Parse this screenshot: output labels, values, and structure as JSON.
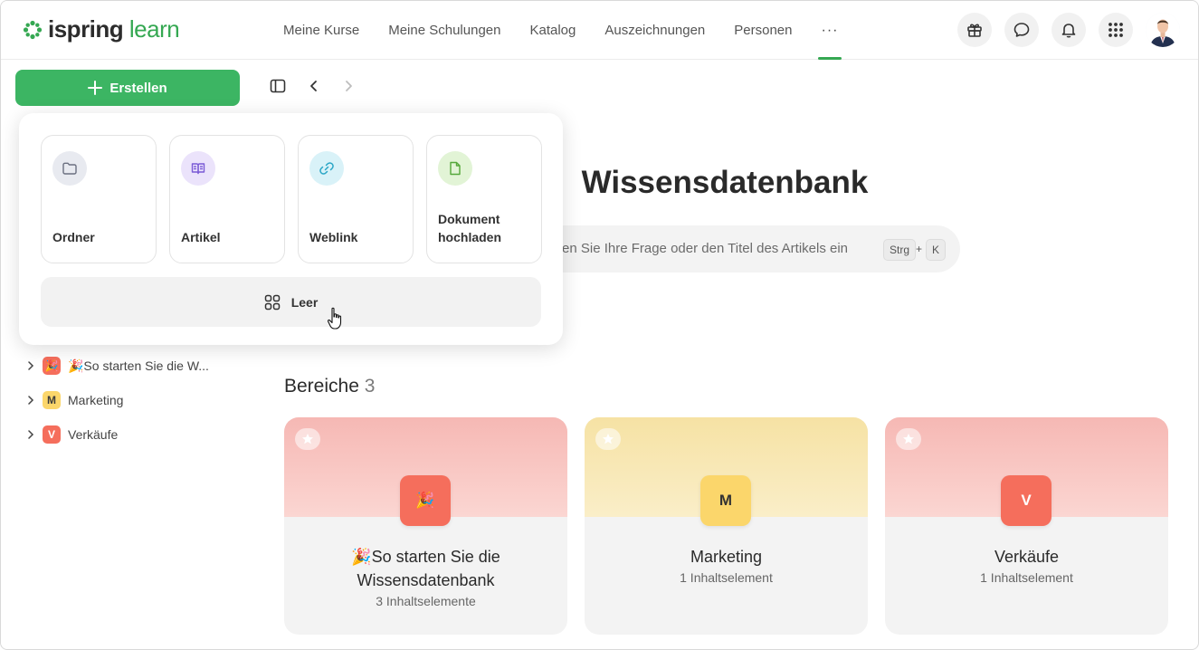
{
  "header": {
    "logo": {
      "brand": "ispring",
      "product": "learn"
    },
    "nav": [
      {
        "label": "Meine Kurse"
      },
      {
        "label": "Meine Schulungen"
      },
      {
        "label": "Katalog"
      },
      {
        "label": "Auszeichnungen"
      },
      {
        "label": "Personen"
      },
      {
        "label": "···"
      }
    ],
    "icons": [
      "gift-icon",
      "chat-icon",
      "bell-icon",
      "apps-grid-icon"
    ]
  },
  "sidebar": {
    "create_label": "Erstellen",
    "tree": [
      {
        "badge": "🎉",
        "label": "🎉So starten Sie die W...",
        "color": "#f56e5c"
      },
      {
        "badge": "M",
        "label": "Marketing",
        "color": "#fbd66b"
      },
      {
        "badge": "V",
        "label": "Verkäufe",
        "color": "#f56e5c"
      }
    ]
  },
  "main": {
    "title": "Wissensdatenbank",
    "search": {
      "placeholder": "en Sie Ihre Frage oder den Titel des Artikels ein",
      "key1": "Strg",
      "plus": "+",
      "key2": "K"
    },
    "section": {
      "label": "Bereiche",
      "count": "3"
    },
    "cards": [
      {
        "icon": "🎉",
        "name": "🎉So starten Sie die Wissensdatenbank",
        "sub": "3 Inhaltselemente",
        "color": "#f56e5c"
      },
      {
        "icon": "M",
        "name": "Marketing",
        "sub": "1 Inhaltselement",
        "color": "#fbd66b"
      },
      {
        "icon": "V",
        "name": "Verkäufe",
        "sub": "1 Inhaltselement",
        "color": "#f56e5c"
      }
    ]
  },
  "popup": {
    "tiles": [
      {
        "label": "Ordner",
        "icon": "folder-icon",
        "bg": "#e8eaf0"
      },
      {
        "label": "Artikel",
        "icon": "book-icon",
        "bg": "#ebe3fb"
      },
      {
        "label": "Weblink",
        "icon": "link-icon",
        "bg": "#d9f2f8"
      },
      {
        "label": "Dokument hochladen",
        "icon": "document-icon",
        "bg": "#e2f4d6"
      }
    ],
    "blank_label": "Leer"
  },
  "colors": {
    "accent": "#3cb563"
  }
}
